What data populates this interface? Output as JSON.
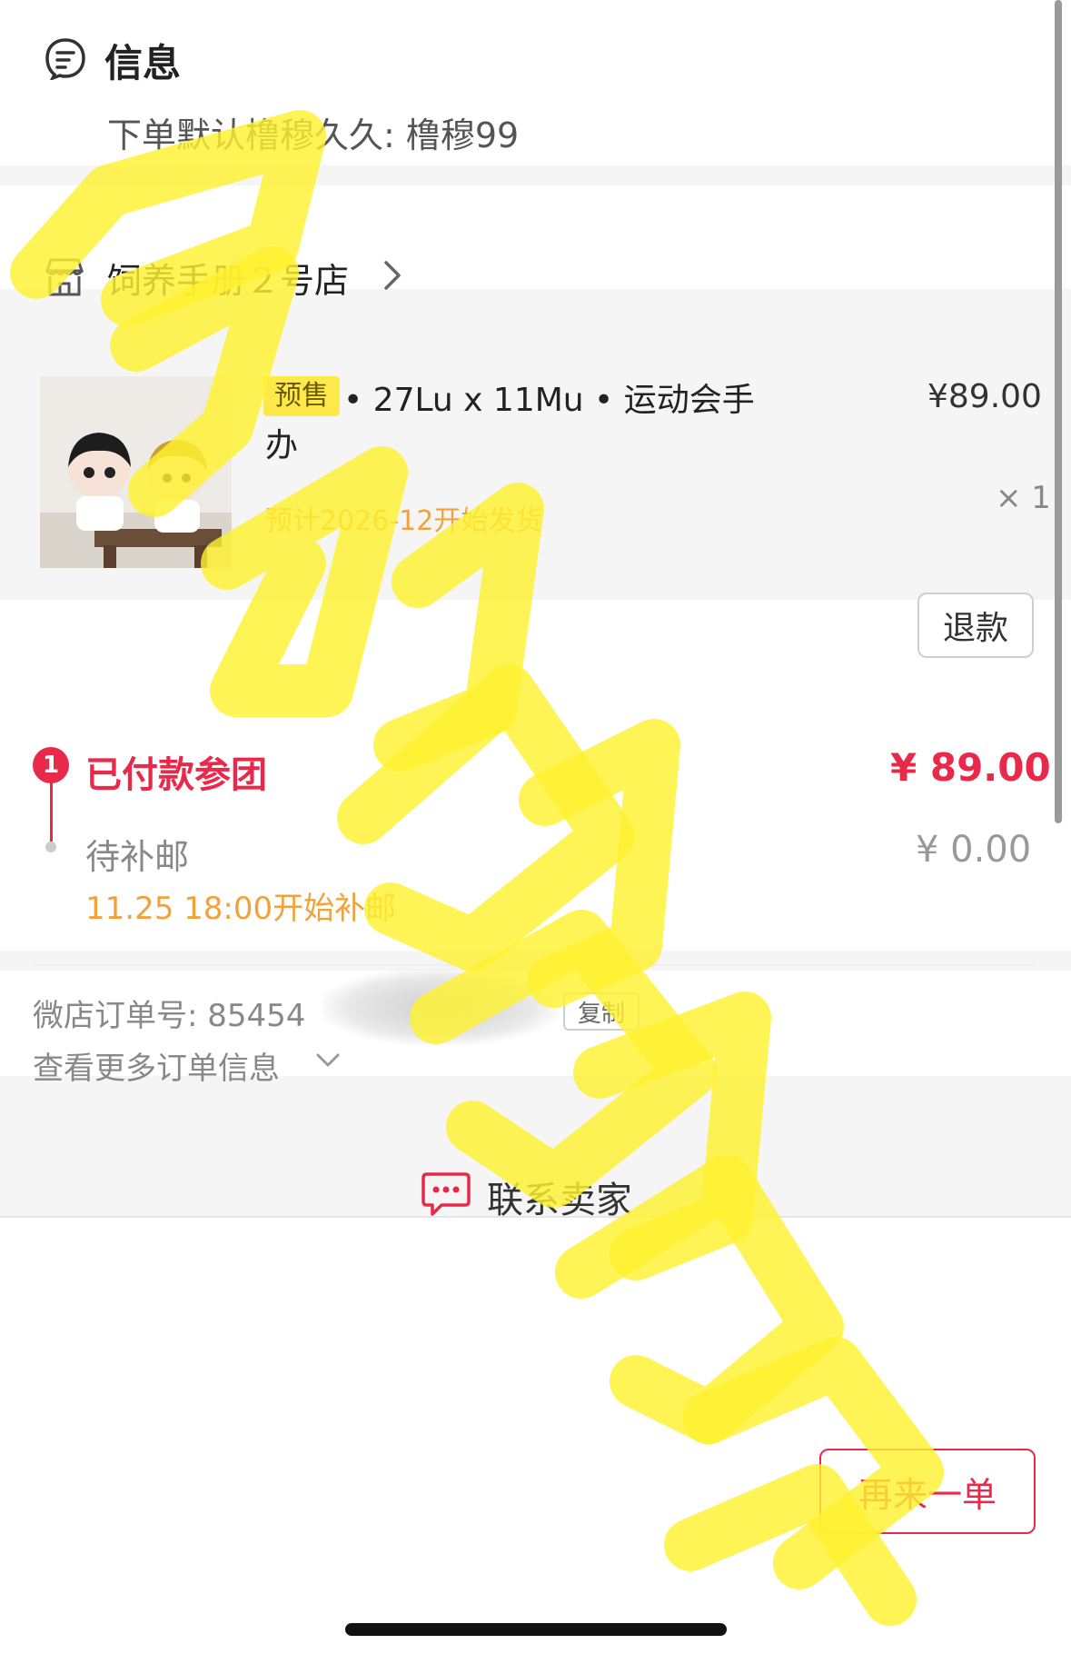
{
  "info": {
    "title": "信息",
    "default_line": "下单默认橹穆久久: 橹穆99"
  },
  "shop": {
    "name": "饲养手册２号店"
  },
  "product": {
    "presale_badge": "预售",
    "title": "• 27Lu x 11Mu • 运动会手办",
    "price": "¥89.00",
    "ship_estimate": "预计2026-12开始发货",
    "quantity": "× 1",
    "refund_label": "退款"
  },
  "status": {
    "step_number": "1",
    "paid_label": "已付款参团",
    "paid_amount": "¥ 89.00",
    "pending_label": "待补邮",
    "pending_amount": "¥ 0.00",
    "pending_start": "11.25 18:00开始补邮"
  },
  "order": {
    "number_label": "微店订单号:  85454",
    "copy_label": "复制",
    "more_info_label": "查看更多订单信息"
  },
  "contact": {
    "label": "联系卖家"
  },
  "footer": {
    "reorder_label": "再来一单"
  },
  "colors": {
    "accent_red": "#e8294a",
    "orange": "#f2a23a",
    "watermark_yellow": "#fff230"
  }
}
